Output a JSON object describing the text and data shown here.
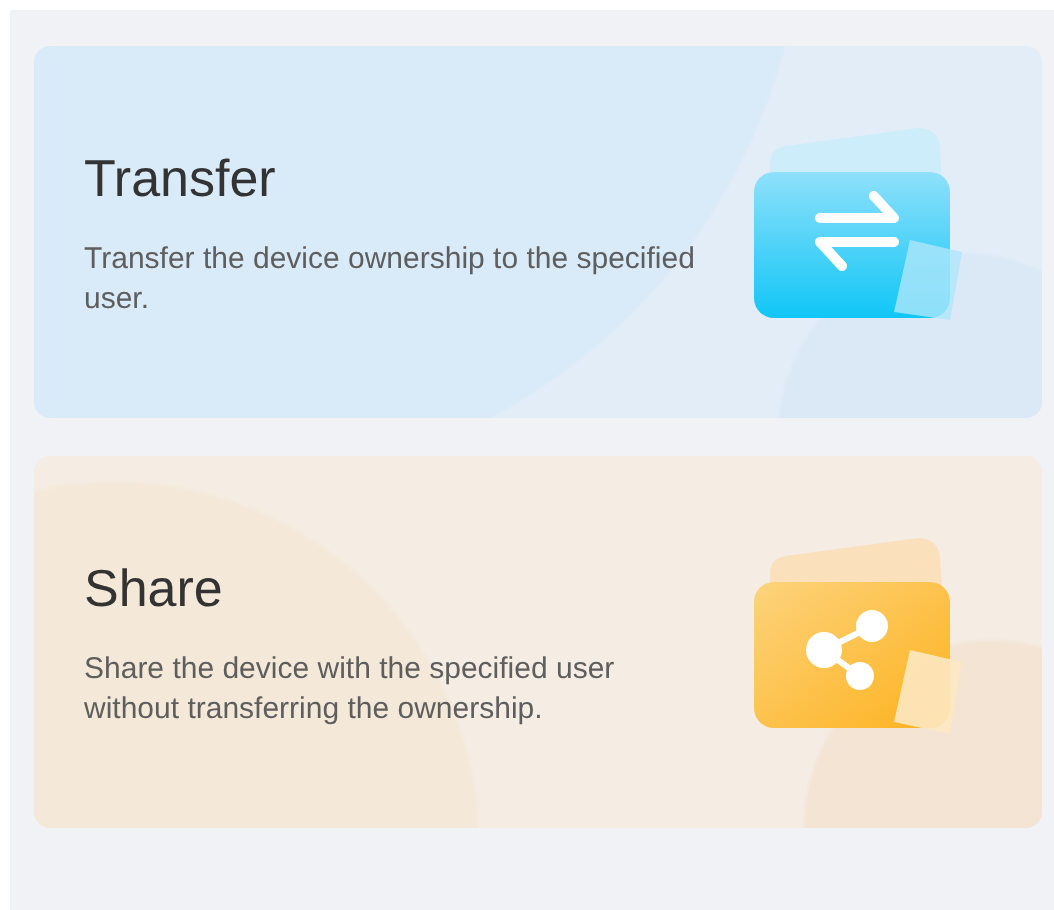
{
  "options": [
    {
      "kind": "transfer",
      "title": "Transfer",
      "description": "Transfer the device ownership to the specified user."
    },
    {
      "kind": "share",
      "title": "Share",
      "description": "Share the device with the specified user without transferring the ownership."
    }
  ]
}
